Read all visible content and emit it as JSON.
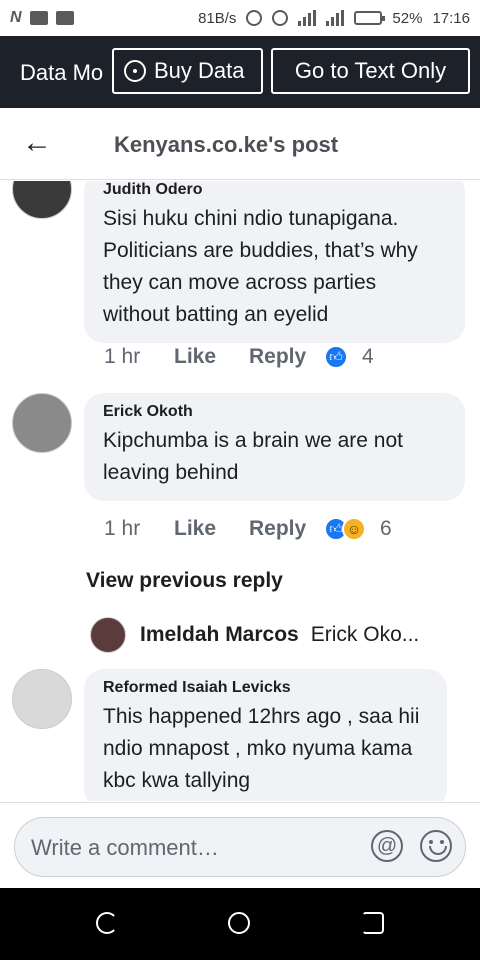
{
  "status_bar": {
    "net_speed": "81B/s",
    "battery": "52%",
    "time": "17:16",
    "battery_level": 0.52
  },
  "data_banner": {
    "label": "Data Mo",
    "buy_data": "Buy Data",
    "text_only": "Go to Text Only"
  },
  "header": {
    "title": "Kenyans.co.ke's post"
  },
  "comments": [
    {
      "author": "Judith Odero",
      "text": "Sisi huku chini ndio tunapigana. Politicians are buddies, that’s why they can move across parties without batting an eyelid",
      "time": "1 hr",
      "like": "Like",
      "reply": "Reply",
      "reactions": [
        "like"
      ],
      "count": "4"
    },
    {
      "author": "Erick Okoth",
      "text": "Kipchumba is a brain we are not leaving behind",
      "time": "1 hr",
      "like": "Like",
      "reply": "Reply",
      "reactions": [
        "like",
        "haha"
      ],
      "count": "6"
    },
    {
      "author": "Reformed Isaiah Levicks",
      "text": "This happened 12hrs ago , saa hii ndio mnapost , mko nyuma kama kbc kwa tallying"
    }
  ],
  "view_previous": "View previous reply",
  "reply_preview": {
    "name": "Imeldah Marcos",
    "snippet": "Erick Oko..."
  },
  "composer": {
    "placeholder": "Write a comment…"
  },
  "colors": {
    "banner_bg": "#1d2129",
    "bubble_bg": "#f0f2f5",
    "like_blue": "#1877f2"
  }
}
